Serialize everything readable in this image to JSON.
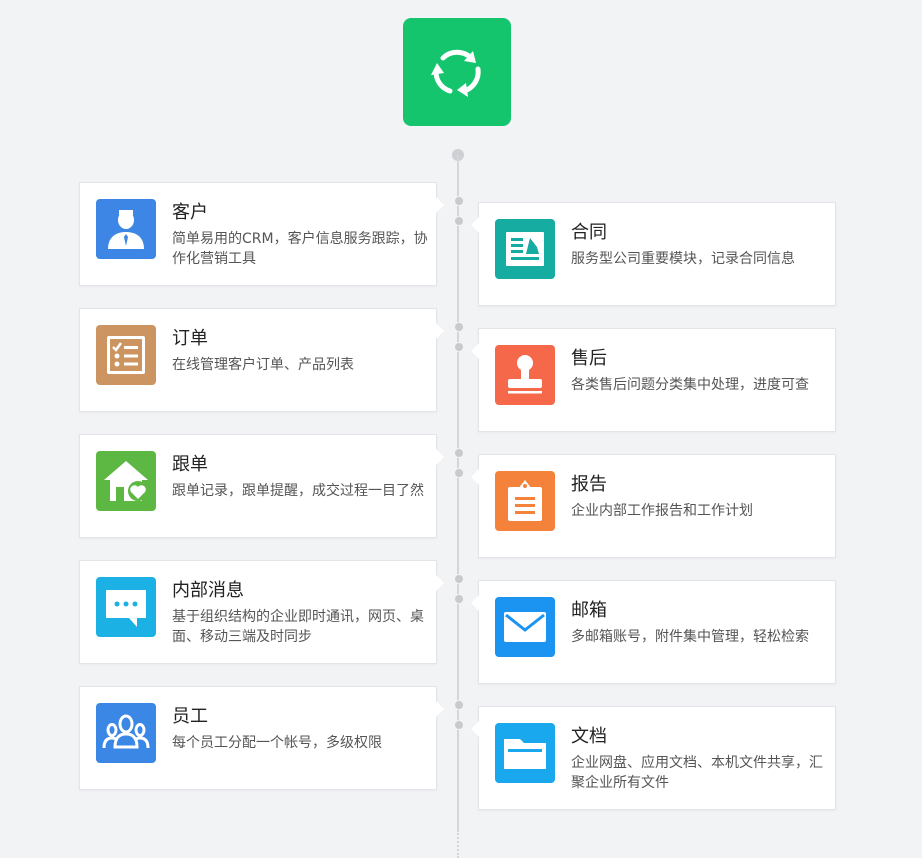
{
  "colors": {
    "logo": "#14c56d",
    "customer": "#3d86e6",
    "contract": "#17aca2",
    "order": "#cc9460",
    "aftersale": "#f5694a",
    "followup": "#5cb843",
    "report": "#f5823a",
    "message": "#1bb1e4",
    "mail": "#1b93f0",
    "staff": "#3a87e6",
    "docs": "#19a8ee"
  },
  "cards": {
    "customer": {
      "icon": "customer-person-icon",
      "title": "客户",
      "desc": "简单易用的CRM，客户信息服务跟踪，协作化营销工具"
    },
    "contract": {
      "icon": "contract-document-icon",
      "title": "合同",
      "desc": "服务型公司重要模块，记录合同信息"
    },
    "order": {
      "icon": "order-checklist-icon",
      "title": "订单",
      "desc": "在线管理客户订单、产品列表"
    },
    "aftersale": {
      "icon": "aftersale-stamp-icon",
      "title": "售后",
      "desc": "各类售后问题分类集中处理，进度可查"
    },
    "followup": {
      "icon": "followup-house-heart-icon",
      "title": "跟单",
      "desc": "跟单记录，跟单提醒，成交过程一目了然"
    },
    "report": {
      "icon": "report-clipboard-icon",
      "title": "报告",
      "desc": "企业内部工作报告和工作计划"
    },
    "message": {
      "icon": "message-bubble-icon",
      "title": "内部消息",
      "desc": "基于组织结构的企业即时通讯，网页、桌面、移动三端及时同步"
    },
    "mail": {
      "icon": "mail-envelope-icon",
      "title": "邮箱",
      "desc": "多邮箱账号，附件集中管理，轻松检索"
    },
    "staff": {
      "icon": "staff-group-icon",
      "title": "员工",
      "desc": "每个员工分配一个帐号，多级权限"
    },
    "docs": {
      "icon": "docs-folder-icon",
      "title": "文档",
      "desc": "企业网盘、应用文档、本机文件共享，汇聚企业所有文件"
    }
  }
}
